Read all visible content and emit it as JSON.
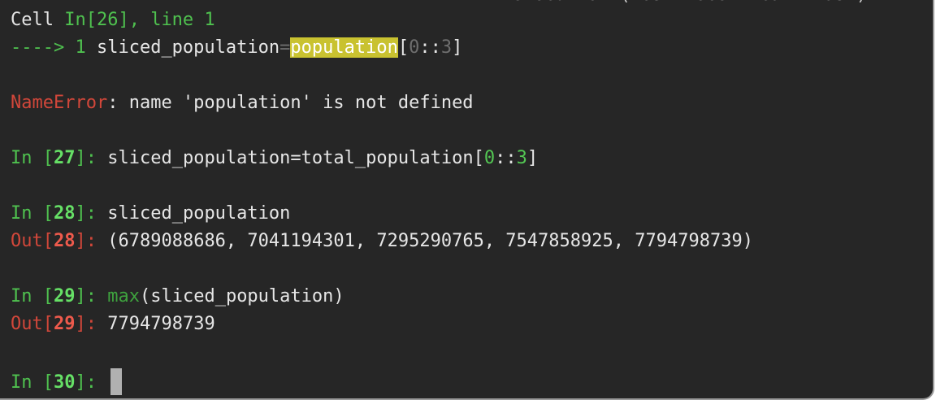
{
  "top_fragment": "execution (most recent call last)",
  "traceback": {
    "cell_label": "Cell ",
    "cell_ref": "In[26], line 1",
    "arrow": "----> 1 ",
    "code_pre": "sliced_population",
    "code_eq": "=",
    "code_highlight": "population",
    "code_open": "[",
    "code_zero": "0",
    "code_colons": "::",
    "code_three": "3",
    "code_close": "]"
  },
  "error": {
    "name": "NameError",
    "message": ": name 'population' is not defined"
  },
  "cells": [
    {
      "in_prefix": "In [",
      "in_num": "27",
      "in_suffix": "]: ",
      "code_pre": "sliced_population=total_population[",
      "code_zero": "0",
      "code_colons": "::",
      "code_three": "3",
      "code_close": "]"
    },
    {
      "in_prefix": "In [",
      "in_num": "28",
      "in_suffix": "]: ",
      "code": "sliced_population",
      "out_prefix": "Out[",
      "out_num": "28",
      "out_suffix": "]: ",
      "output": "(6789088686, 7041194301, 7295290765, 7547858925, 7794798739)"
    },
    {
      "in_prefix": "In [",
      "in_num": "29",
      "in_suffix": "]: ",
      "code_fn": "max",
      "code_rest": "(sliced_population)",
      "out_prefix": "Out[",
      "out_num": "29",
      "out_suffix": "]: ",
      "output": "7794798739"
    },
    {
      "in_prefix": "In [",
      "in_num": "30",
      "in_suffix": "]: "
    }
  ],
  "colors": {
    "background": "#262626",
    "prompt_green": "#4fc14f",
    "prompt_red": "#d2473a",
    "highlight": "#c9c230",
    "cursor": "#b0b0b0"
  }
}
